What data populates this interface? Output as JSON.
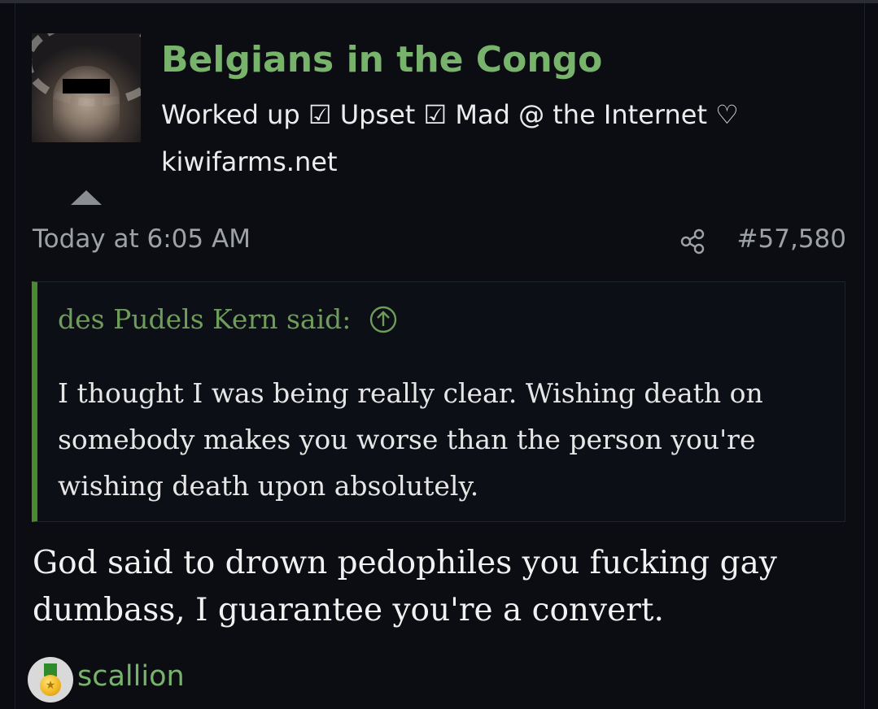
{
  "user": {
    "display_name": "Belgians in the Congo",
    "custom_title": "Worked up ☑ Upset ☑ Mad @ the Internet ♡",
    "site": "kiwifarms.net"
  },
  "post": {
    "timestamp": "Today at 6:05 AM",
    "post_number": "#57,580",
    "quote": {
      "author_line": "des Pudels Kern said:",
      "text": "I thought I was being really clear. Wishing death on somebody makes you worse than the person you're wishing death upon absolutely."
    },
    "message": "God said to drown pedophiles you fucking gay dumbass, I guarantee you're a convert.",
    "reaction": {
      "icon": "gold-medal-icon",
      "label": "scallion"
    }
  },
  "colors": {
    "background": "#0b0d13",
    "username": "#78b36c",
    "quote_bar": "#4b8a2f",
    "meta_text": "#9ea1a6"
  }
}
